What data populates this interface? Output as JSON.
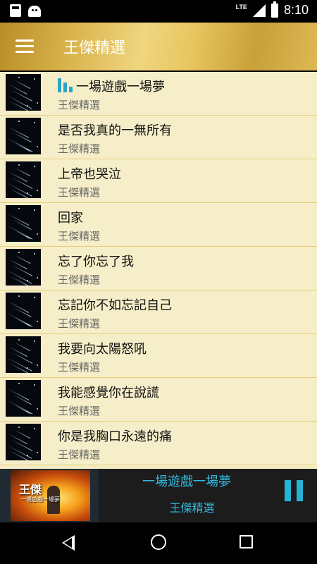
{
  "status_bar": {
    "network": "LTE",
    "time": "8:10",
    "icons": [
      "sd-card-icon",
      "android-icon",
      "signal-icon",
      "battery-icon"
    ]
  },
  "app_bar": {
    "title": "王傑精選",
    "menu_icon": "hamburger-menu-icon"
  },
  "songs": [
    {
      "title": "一場遊戲一場夢",
      "subtitle": "王傑精選",
      "playing": true
    },
    {
      "title": "是否我真的一無所有",
      "subtitle": "王傑精選"
    },
    {
      "title": "上帝也哭泣",
      "subtitle": "王傑精選"
    },
    {
      "title": "回家",
      "subtitle": "王傑精選"
    },
    {
      "title": "忘了你忘了我",
      "subtitle": "王傑精選"
    },
    {
      "title": "忘記你不如忘記自己",
      "subtitle": "王傑精選"
    },
    {
      "title": "我要向太陽怒吼",
      "subtitle": "王傑精選"
    },
    {
      "title": "我能感覺你在說謊",
      "subtitle": "王傑精選"
    },
    {
      "title": "你是我胸口永遠的痛",
      "subtitle": "王傑精選"
    }
  ],
  "now_playing": {
    "title": "一場遊戲一場夢",
    "subtitle": "王傑精選",
    "album_art_text": "王傑",
    "album_art_subtext": "一場遊戲一場夢",
    "button_icon": "pause-icon"
  },
  "nav_bar": {
    "icons": [
      "back-icon",
      "home-icon",
      "recents-icon"
    ]
  },
  "colors": {
    "accent": "#2ba6c6",
    "list_background": "#f6eec9",
    "divider": "#e6cf7a",
    "app_bar_gold": "#d8b24a"
  }
}
